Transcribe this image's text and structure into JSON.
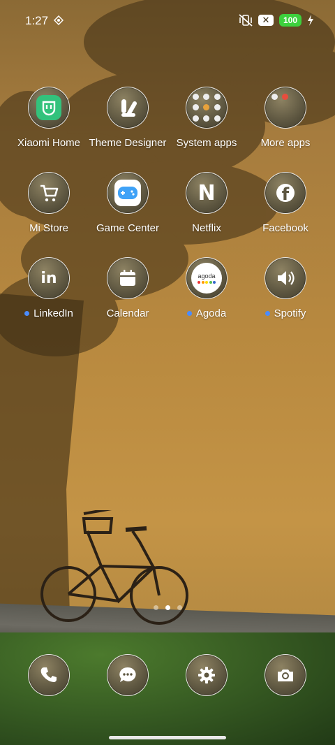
{
  "status_bar": {
    "time": "1:27",
    "battery": "100",
    "x_icon": "✕"
  },
  "apps": [
    {
      "label": "Xiaomi Home",
      "icon": "mi-home-icon",
      "dot": false
    },
    {
      "label": "Theme Designer",
      "icon": "theme-designer-icon",
      "dot": false
    },
    {
      "label": "System apps",
      "icon": "folder-icon",
      "dot": false
    },
    {
      "label": "More apps",
      "icon": "folder-icon",
      "dot": false
    },
    {
      "label": "Mi Store",
      "icon": "cart-icon",
      "dot": false
    },
    {
      "label": "Game Center",
      "icon": "gamepad-icon",
      "dot": false
    },
    {
      "label": "Netflix",
      "icon": "netflix-icon",
      "dot": false
    },
    {
      "label": "Facebook",
      "icon": "facebook-icon",
      "dot": false
    },
    {
      "label": "LinkedIn",
      "icon": "linkedin-icon",
      "dot": true
    },
    {
      "label": "Calendar",
      "icon": "calendar-icon",
      "dot": false
    },
    {
      "label": "Agoda",
      "icon": "agoda-icon",
      "dot": true
    },
    {
      "label": "Spotify",
      "icon": "speaker-icon",
      "dot": true
    }
  ],
  "agoda_wordmark": "agoda",
  "netflix_letter": "N",
  "linkedin_letters": "in",
  "facebook_letter": "f",
  "dock": [
    {
      "icon": "phone-icon"
    },
    {
      "icon": "messages-icon"
    },
    {
      "icon": "settings-icon"
    },
    {
      "icon": "camera-icon"
    }
  ],
  "pager": {
    "pages": 3,
    "active": 2
  },
  "colors": {
    "notification_dot": "#4a8cff",
    "battery": "#3dd13d",
    "mi_home": "#33c27c"
  }
}
